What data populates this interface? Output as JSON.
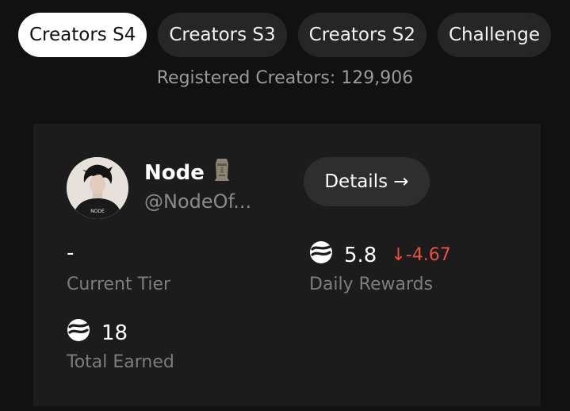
{
  "tabs": [
    {
      "label": "Creators S4",
      "active": true
    },
    {
      "label": "Creators S3",
      "active": false
    },
    {
      "label": "Creators S2",
      "active": false
    },
    {
      "label": "Challenge",
      "active": false
    }
  ],
  "registered_text": "Registered Creators: 129,906",
  "profile": {
    "name": "Node",
    "emoji_icon": "moai-icon",
    "handle": "@NodeOf...",
    "avatar_text": "NODE"
  },
  "details_button": {
    "label": "Details →"
  },
  "stats": {
    "current_tier": {
      "value": "-",
      "label": "Current Tier"
    },
    "daily_rewards": {
      "value": "5.8",
      "delta": "↓-4.67",
      "label": "Daily Rewards",
      "icon": "token-icon"
    },
    "total_earned": {
      "value": "18",
      "label": "Total Earned",
      "icon": "token-icon"
    }
  },
  "colors": {
    "background": "#111111",
    "card": "#1c1c1c",
    "tab_inactive": "#262626",
    "tab_active": "#ffffff",
    "delta_negative": "#e5533d"
  }
}
